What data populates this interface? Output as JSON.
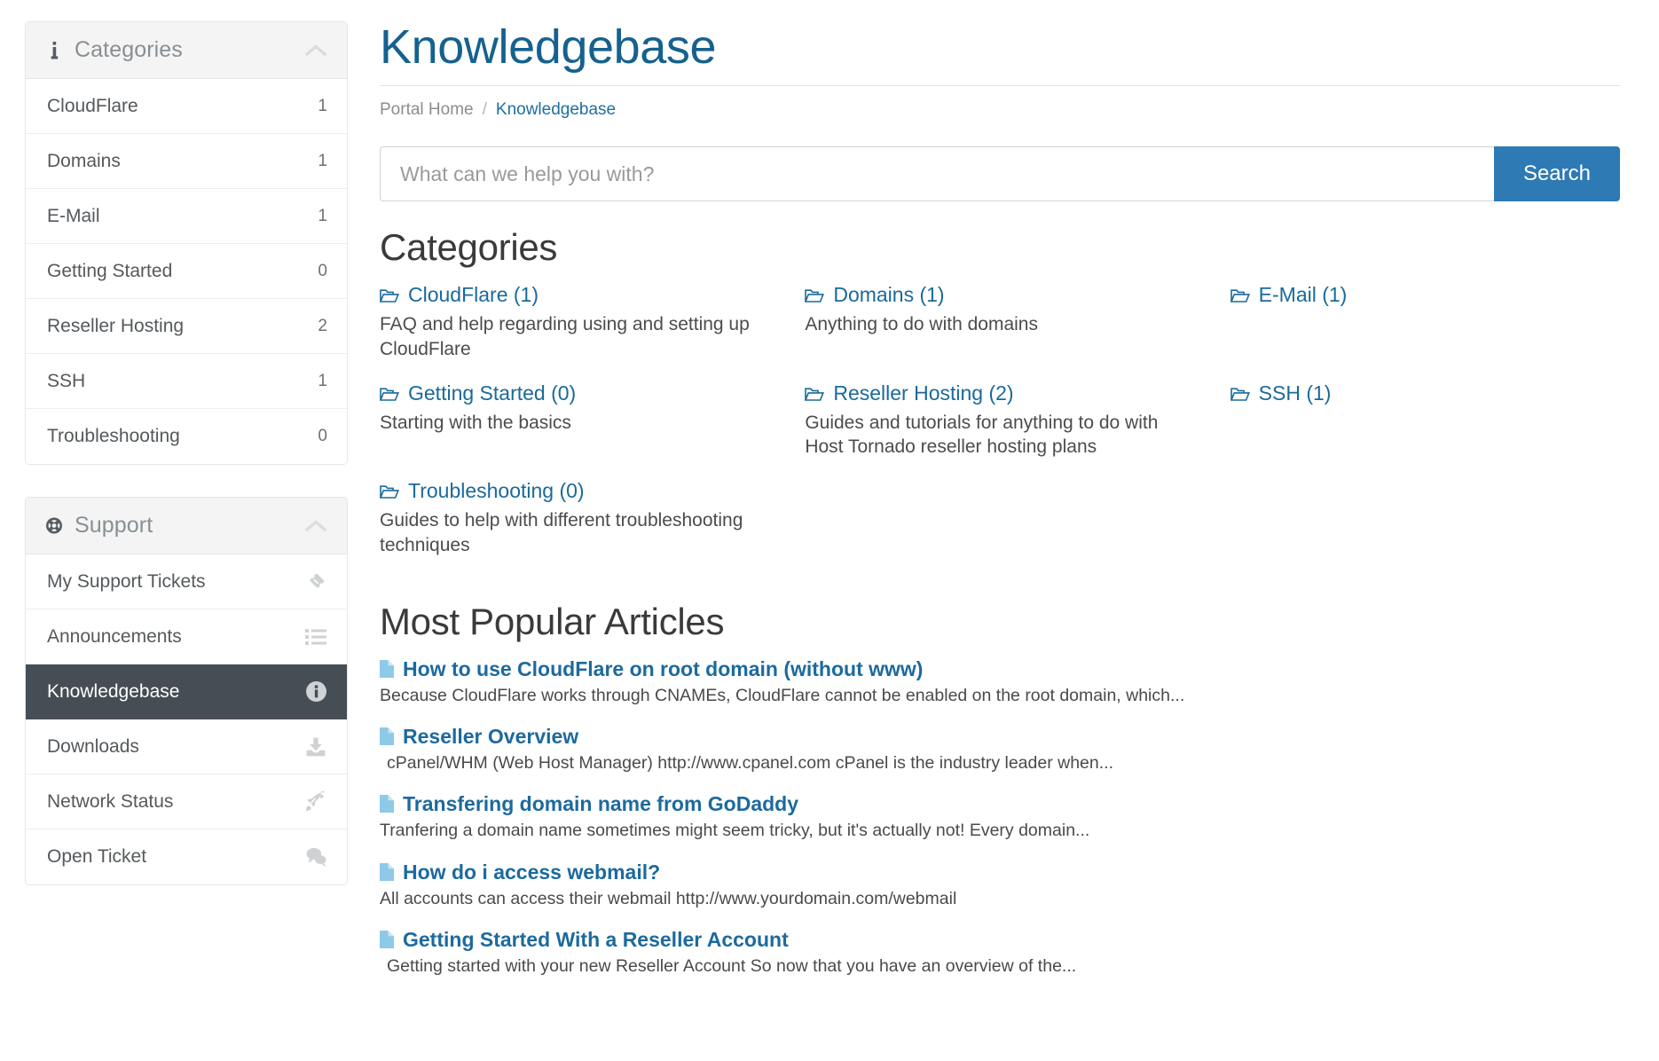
{
  "sidebar": {
    "categories_panel": {
      "title": "Categories",
      "icon": "info-icon",
      "collapse_icon": "chevron-up-icon",
      "items": [
        {
          "label": "CloudFlare",
          "count": "1"
        },
        {
          "label": "Domains",
          "count": "1"
        },
        {
          "label": "E-Mail",
          "count": "1"
        },
        {
          "label": "Getting Started",
          "count": "0"
        },
        {
          "label": "Reseller Hosting",
          "count": "2"
        },
        {
          "label": "SSH",
          "count": "1"
        },
        {
          "label": "Troubleshooting",
          "count": "0"
        }
      ]
    },
    "support_panel": {
      "title": "Support",
      "icon": "lifebuoy-icon",
      "collapse_icon": "chevron-up-icon",
      "items": [
        {
          "label": "My Support Tickets",
          "icon": "ticket-icon",
          "active": false
        },
        {
          "label": "Announcements",
          "icon": "list-icon",
          "active": false
        },
        {
          "label": "Knowledgebase",
          "icon": "info-circle-icon",
          "active": true
        },
        {
          "label": "Downloads",
          "icon": "download-icon",
          "active": false
        },
        {
          "label": "Network Status",
          "icon": "rocket-icon",
          "active": false
        },
        {
          "label": "Open Ticket",
          "icon": "comments-icon",
          "active": false
        }
      ]
    }
  },
  "header": {
    "title": "Knowledgebase",
    "breadcrumb": {
      "home": "Portal Home",
      "separator": "/",
      "current": "Knowledgebase"
    }
  },
  "search": {
    "placeholder": "What can we help you with?",
    "value": "",
    "button_label": "Search"
  },
  "categories_section": {
    "title": "Categories",
    "items": [
      {
        "label": "CloudFlare (1)",
        "description": "FAQ and help regarding using and setting up CloudFlare",
        "icon": "folder-open-icon"
      },
      {
        "label": "Domains (1)",
        "description": "Anything to do with domains",
        "icon": "folder-open-icon"
      },
      {
        "label": "E-Mail (1)",
        "description": "",
        "icon": "folder-open-icon"
      },
      {
        "label": "Getting Started (0)",
        "description": "Starting with the basics",
        "icon": "folder-open-icon"
      },
      {
        "label": "Reseller Hosting (2)",
        "description": "Guides and tutorials for anything to do with Host Tornado reseller hosting plans",
        "icon": "folder-open-icon"
      },
      {
        "label": "SSH (1)",
        "description": "",
        "icon": "folder-open-icon"
      },
      {
        "label": "Troubleshooting (0)",
        "description": "Guides to help with different troubleshooting techniques",
        "icon": "folder-open-icon"
      }
    ]
  },
  "articles_section": {
    "title": "Most Popular Articles",
    "items": [
      {
        "title": "How to use CloudFlare on root domain (without www)",
        "excerpt": "Because CloudFlare works through CNAMEs, CloudFlare cannot be enabled on the root domain, which...",
        "icon": "file-icon",
        "indented": false
      },
      {
        "title": "Reseller Overview",
        "excerpt": "cPanel/WHM (Web Host Manager) http://www.cpanel.com cPanel is the industry leader when...",
        "icon": "file-icon",
        "indented": true
      },
      {
        "title": "Transfering domain name from GoDaddy",
        "excerpt": "Tranfering a domain name sometimes might seem tricky, but it's actually not!  Every domain...",
        "icon": "file-icon",
        "indented": false
      },
      {
        "title": "How do i access webmail?",
        "excerpt": "All accounts can access their webmail http://www.yourdomain.com/webmail",
        "icon": "file-icon",
        "indented": false
      },
      {
        "title": "Getting Started With a Reseller Account",
        "excerpt": "Getting started with your new Reseller Account So now that you have an overview of the...",
        "icon": "file-icon",
        "indented": true
      }
    ]
  },
  "colors": {
    "title_blue": "#15618f",
    "link_blue": "#1a6a9a",
    "button_blue": "#2e7ab5",
    "active_dark": "#464e55",
    "file_icon_blue": "#8ec9e8"
  }
}
